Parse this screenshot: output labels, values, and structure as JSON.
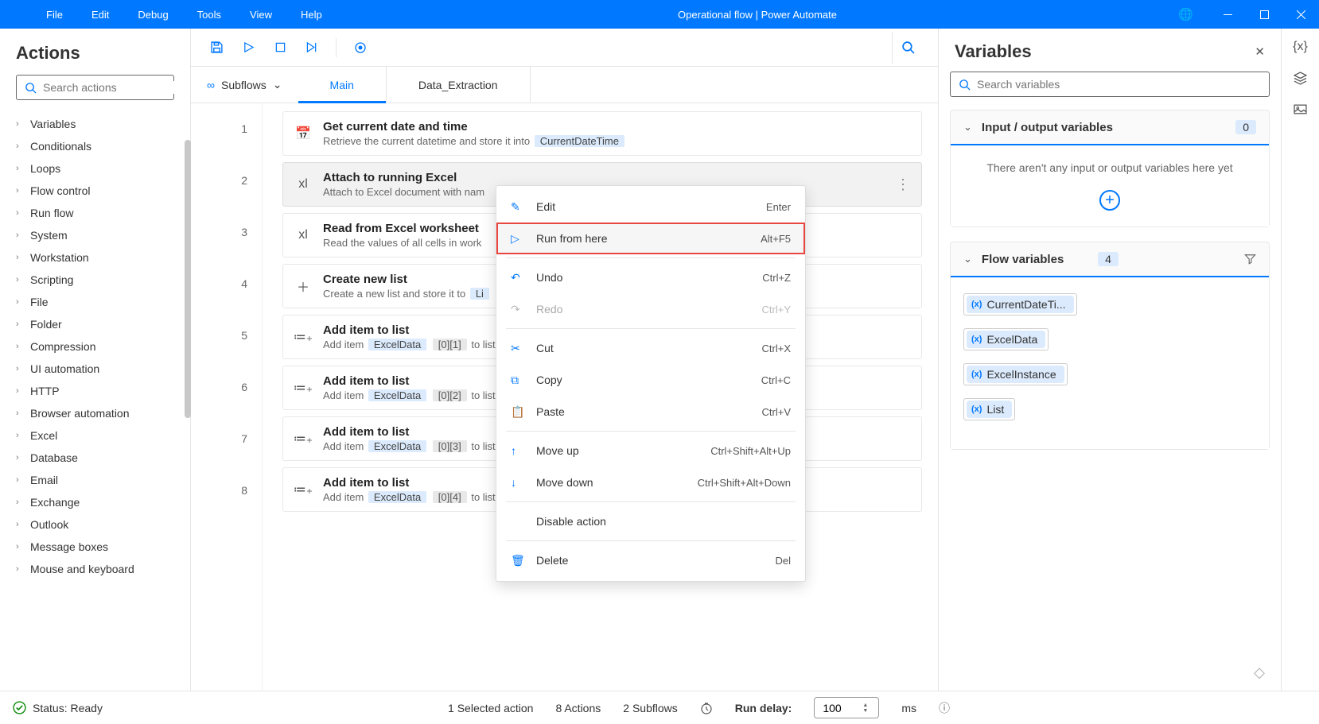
{
  "titlebar": {
    "menus": [
      "File",
      "Edit",
      "Debug",
      "Tools",
      "View",
      "Help"
    ],
    "title": "Operational flow | Power Automate"
  },
  "actions": {
    "heading": "Actions",
    "search_placeholder": "Search actions",
    "categories": [
      "Variables",
      "Conditionals",
      "Loops",
      "Flow control",
      "Run flow",
      "System",
      "Workstation",
      "Scripting",
      "File",
      "Folder",
      "Compression",
      "UI automation",
      "HTTP",
      "Browser automation",
      "Excel",
      "Database",
      "Email",
      "Exchange",
      "Outlook",
      "Message boxes",
      "Mouse and keyboard"
    ]
  },
  "subflows": {
    "label": "Subflows",
    "tabs": [
      "Main",
      "Data_Extraction"
    ],
    "active": 0
  },
  "steps": [
    {
      "num": "1",
      "title": "Get current date and time",
      "desc_prefix": "Retrieve the current datetime and store it into ",
      "chip": "CurrentDateTime",
      "icon": "📅"
    },
    {
      "num": "2",
      "title": "Attach to running Excel",
      "desc_prefix": "Attach to Excel document with nam",
      "chip": "",
      "icon": "xl",
      "selected": true,
      "more": true
    },
    {
      "num": "3",
      "title": "Read from Excel worksheet",
      "desc_prefix": "Read the values of all cells in work",
      "chip": "",
      "icon": "xl"
    },
    {
      "num": "4",
      "title": "Create new list",
      "desc_prefix": "Create a new list and store it to ",
      "chip": "Li",
      "icon": "＋"
    },
    {
      "num": "5",
      "title": "Add item to list",
      "desc_prefix": "Add item ",
      "chip": "ExcelData",
      "idx": "[0][1]",
      "suffix": " to list",
      "icon": "≔₊"
    },
    {
      "num": "6",
      "title": "Add item to list",
      "desc_prefix": "Add item ",
      "chip": "ExcelData",
      "idx": "[0][2]",
      "suffix": " to list",
      "icon": "≔₊"
    },
    {
      "num": "7",
      "title": "Add item to list",
      "desc_prefix": "Add item ",
      "chip": "ExcelData",
      "idx": "[0][3]",
      "suffix": " to list",
      "icon": "≔₊"
    },
    {
      "num": "8",
      "title": "Add item to list",
      "desc_prefix": "Add item ",
      "chip": "ExcelData",
      "idx": "[0][4]",
      "suffix": " to list",
      "icon": "≔₊"
    }
  ],
  "context_menu": [
    {
      "icon": "✎",
      "label": "Edit",
      "shortcut": "Enter"
    },
    {
      "icon": "▷",
      "label": "Run from here",
      "shortcut": "Alt+F5",
      "highlight": true
    },
    {
      "sep": true
    },
    {
      "icon": "↶",
      "label": "Undo",
      "shortcut": "Ctrl+Z"
    },
    {
      "icon": "↷",
      "label": "Redo",
      "shortcut": "Ctrl+Y",
      "disabled": true
    },
    {
      "sep": true
    },
    {
      "icon": "✂",
      "label": "Cut",
      "shortcut": "Ctrl+X"
    },
    {
      "icon": "⧉",
      "label": "Copy",
      "shortcut": "Ctrl+C"
    },
    {
      "icon": "📋",
      "label": "Paste",
      "shortcut": "Ctrl+V"
    },
    {
      "sep": true
    },
    {
      "icon": "↑",
      "label": "Move up",
      "shortcut": "Ctrl+Shift+Alt+Up"
    },
    {
      "icon": "↓",
      "label": "Move down",
      "shortcut": "Ctrl+Shift+Alt+Down"
    },
    {
      "sep": true
    },
    {
      "icon": "",
      "label": "Disable action",
      "shortcut": ""
    },
    {
      "sep": true
    },
    {
      "icon": "🗑",
      "label": "Delete",
      "shortcut": "Del"
    }
  ],
  "variables": {
    "heading": "Variables",
    "search_placeholder": "Search variables",
    "io_section": {
      "title": "Input / output variables",
      "count": "0",
      "empty": "There aren't any input or output variables here yet"
    },
    "flow_section": {
      "title": "Flow variables",
      "count": "4",
      "items": [
        "CurrentDateTi...",
        "ExcelData",
        "ExcelInstance",
        "List"
      ]
    }
  },
  "status": {
    "ready": "Status: Ready",
    "selected": "1 Selected action",
    "actions": "8 Actions",
    "subflows": "2 Subflows",
    "delay_label": "Run delay:",
    "delay_value": "100",
    "delay_unit": "ms"
  }
}
